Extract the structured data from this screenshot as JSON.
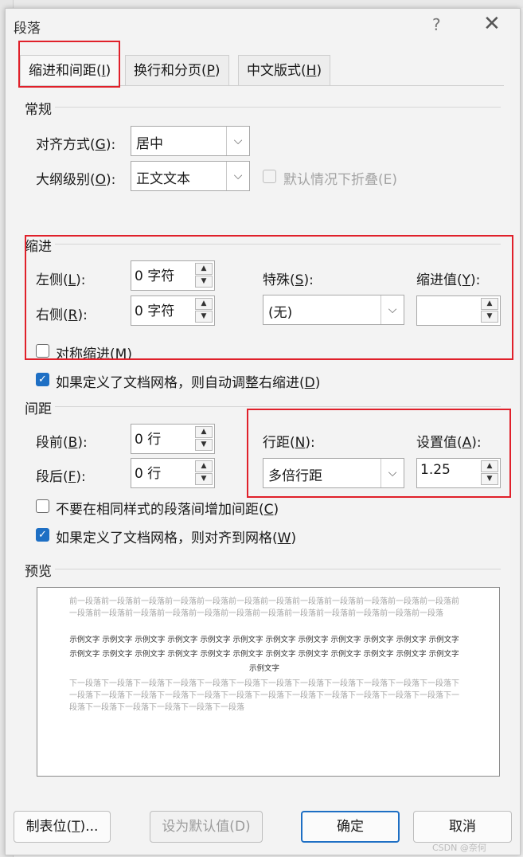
{
  "dialog": {
    "title": "段落",
    "help": "?",
    "close": "✕"
  },
  "tabs": [
    {
      "label": "缩进和间距(",
      "key": "I",
      "suffix": ")"
    },
    {
      "label": "换行和分页(",
      "key": "P",
      "suffix": ")"
    },
    {
      "label": "中文版式(",
      "key": "H",
      "suffix": ")"
    }
  ],
  "general": {
    "heading": "常规",
    "alignment": {
      "pre": "对齐方式(",
      "key": "G",
      "post": "):",
      "value": "居中"
    },
    "outline": {
      "pre": "大纲级别(",
      "key": "O",
      "post": "):",
      "value": "正文文本"
    },
    "collapse": {
      "label": "默认情况下折叠(E)"
    }
  },
  "indent": {
    "heading": "缩进",
    "left": {
      "pre": "左侧(",
      "key": "L",
      "post": "):",
      "value": "0 字符"
    },
    "right": {
      "pre": "右侧(",
      "key": "R",
      "post": "):",
      "value": "0 字符"
    },
    "special": {
      "pre": "特殊(",
      "key": "S",
      "post": "):",
      "value": "(无)"
    },
    "by": {
      "pre": "缩进值(",
      "key": "Y",
      "post": "):",
      "value": ""
    },
    "mirror": {
      "pre": "对称缩进(",
      "key": "M",
      "post": ")"
    },
    "auto_adjust": {
      "pre": "如果定义了文档网格，则自动调整右缩进(",
      "key": "D",
      "post": ")"
    }
  },
  "spacing": {
    "heading": "间距",
    "before": {
      "pre": "段前(",
      "key": "B",
      "post": "):",
      "value": "0 行"
    },
    "after": {
      "pre": "段后(",
      "key": "F",
      "post": "):",
      "value": "0 行"
    },
    "line_spacing": {
      "pre": "行距(",
      "key": "N",
      "post": "):",
      "value": "多倍行距"
    },
    "at": {
      "pre": "设置值(",
      "key": "A",
      "post": "):",
      "value": "1.25"
    },
    "no_space": {
      "pre": "不要在相同样式的段落间增加间距(",
      "key": "C",
      "post": ")"
    },
    "snap_grid": {
      "pre": "如果定义了文档网格，则对齐到网格(",
      "key": "W",
      "post": ")"
    }
  },
  "preview": {
    "heading": "预览",
    "prev_text": "前一段落前一段落前一段落前一段落前一段落前一段落前一段落前一段落前一段落前一段落前一段落前一段落前一段落前一段落前一段落前一段落前一段落前一段落前一段落前一段落前一段落前一段落前一段落前一段落",
    "sample_text": "示例文字 示例文字 示例文字 示例文字 示例文字 示例文字 示例文字 示例文字 示例文字 示例文字 示例文字 示例文字 示例文字 示例文字 示例文字 示例文字 示例文字 示例文字 示例文字 示例文字 示例文字 示例文字 示例文字 示例文字 示例文字",
    "next_text": "下一段落下一段落下一段落下一段落下一段落下一段落下一段落下一段落下一段落下一段落下一段落下一段落下一段落下一段落下一段落下一段落下一段落下一段落下一段落下一段落下一段落下一段落下一段落下一段落下一段落下一段落下一段落下一段落下一段落下一段落"
  },
  "buttons": {
    "tabs": {
      "pre": "制表位(",
      "key": "T",
      "post": ")..."
    },
    "default": "设为默认值(D)",
    "ok": "确定",
    "cancel": "取消"
  },
  "watermark": "CSDN @奈何",
  "colors": {
    "accent": "#1e6fc4",
    "highlight": "#e0202a"
  }
}
